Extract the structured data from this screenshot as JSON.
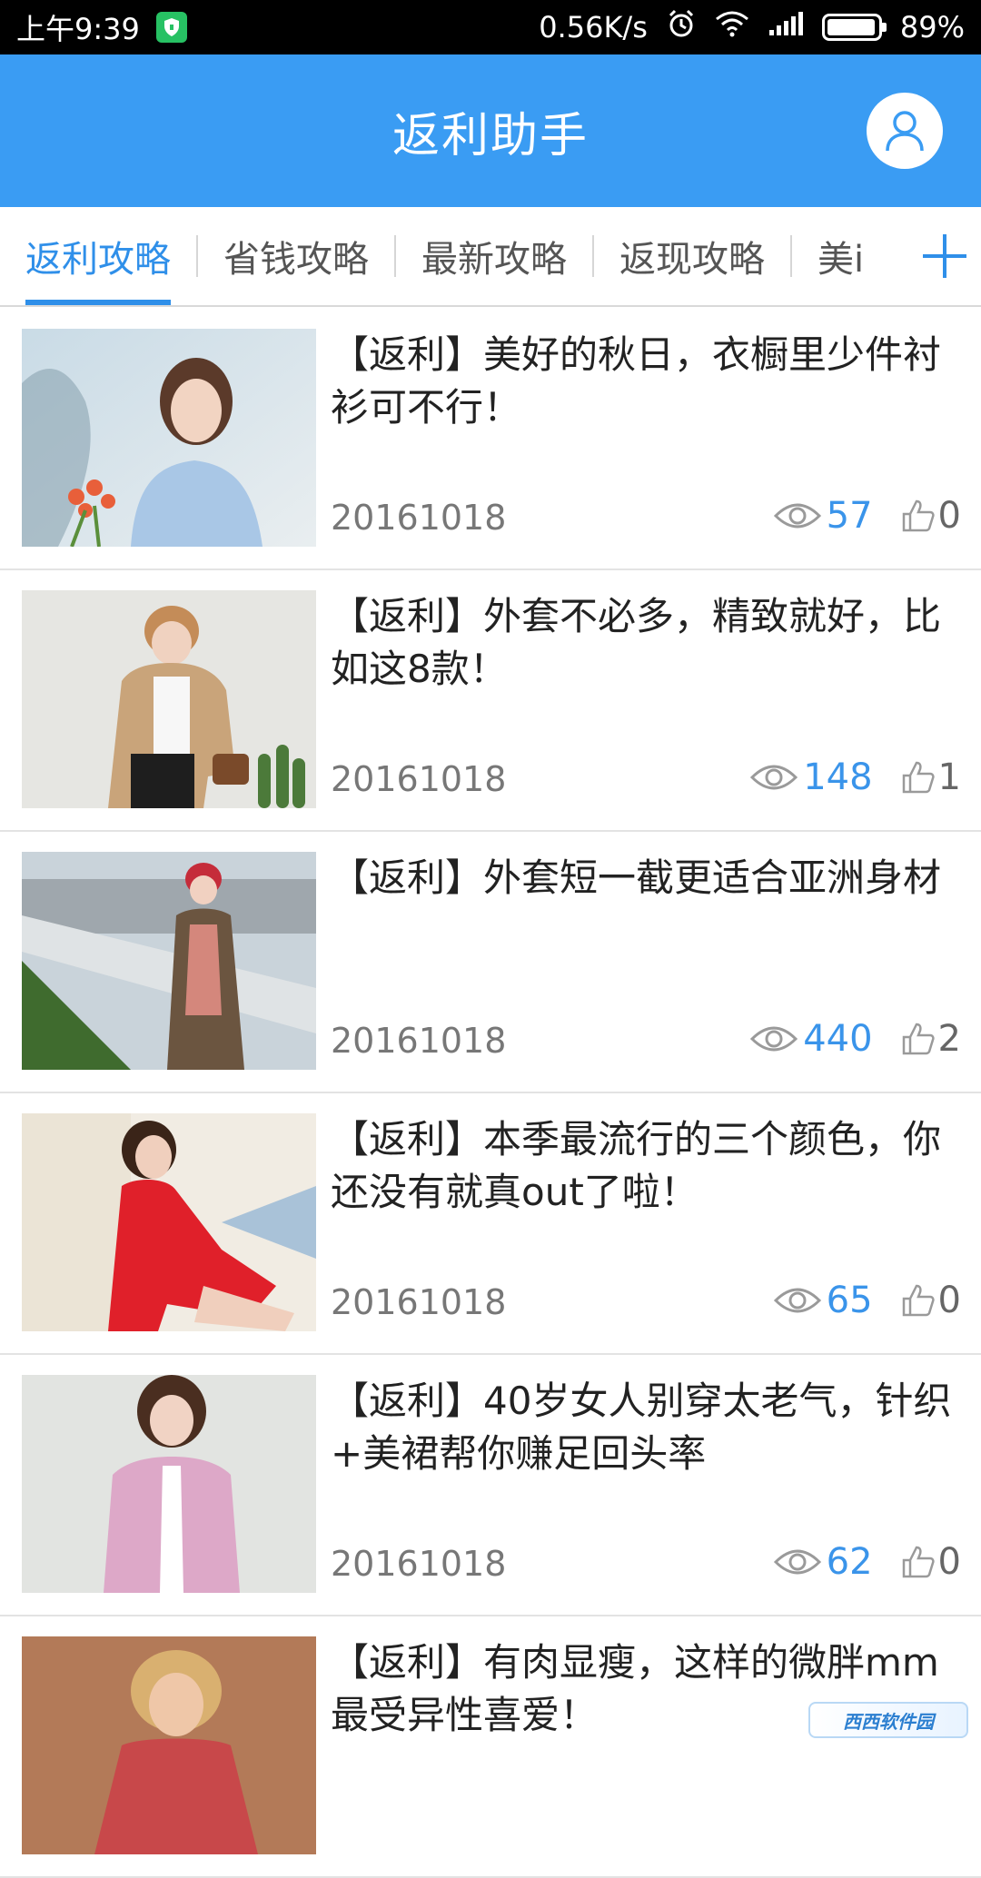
{
  "status_bar": {
    "time": "上午9:39",
    "speed": "0.56K/s",
    "battery": "89%"
  },
  "header": {
    "title": "返利助手",
    "user_icon": "user-icon"
  },
  "tabs": {
    "items": [
      {
        "label": "返利攻略",
        "active": true
      },
      {
        "label": "省钱攻略",
        "active": false
      },
      {
        "label": "最新攻略",
        "active": false
      },
      {
        "label": "返现攻略",
        "active": false
      },
      {
        "label": "美i",
        "active": false
      }
    ],
    "add_icon": "plus-icon"
  },
  "articles": [
    {
      "title": "【返利】美好的秋日，衣橱里少件衬衫可不行！",
      "date": "20161018",
      "views": "57",
      "likes": "0"
    },
    {
      "title": "【返利】外套不必多，精致就好，比如这8款！",
      "date": "20161018",
      "views": "148",
      "likes": "1"
    },
    {
      "title": "【返利】外套短一截更适合亚洲身材",
      "date": "20161018",
      "views": "440",
      "likes": "2"
    },
    {
      "title": "【返利】本季最流行的三个颜色，你还没有就真out了啦！",
      "date": "20161018",
      "views": "65",
      "likes": "0"
    },
    {
      "title": "【返利】40岁女人别穿太老气，针织+美裙帮你赚足回头率",
      "date": "20161018",
      "views": "62",
      "likes": "0"
    },
    {
      "title": "【返利】有肉显瘦，这样的微胖mm最受异性喜爱！",
      "date": "",
      "views": "",
      "likes": ""
    }
  ],
  "watermark": "西西软件园",
  "colors": {
    "header_bg": "#3a9cf3",
    "accent": "#2f8fe9",
    "views": "#3a94ea"
  }
}
